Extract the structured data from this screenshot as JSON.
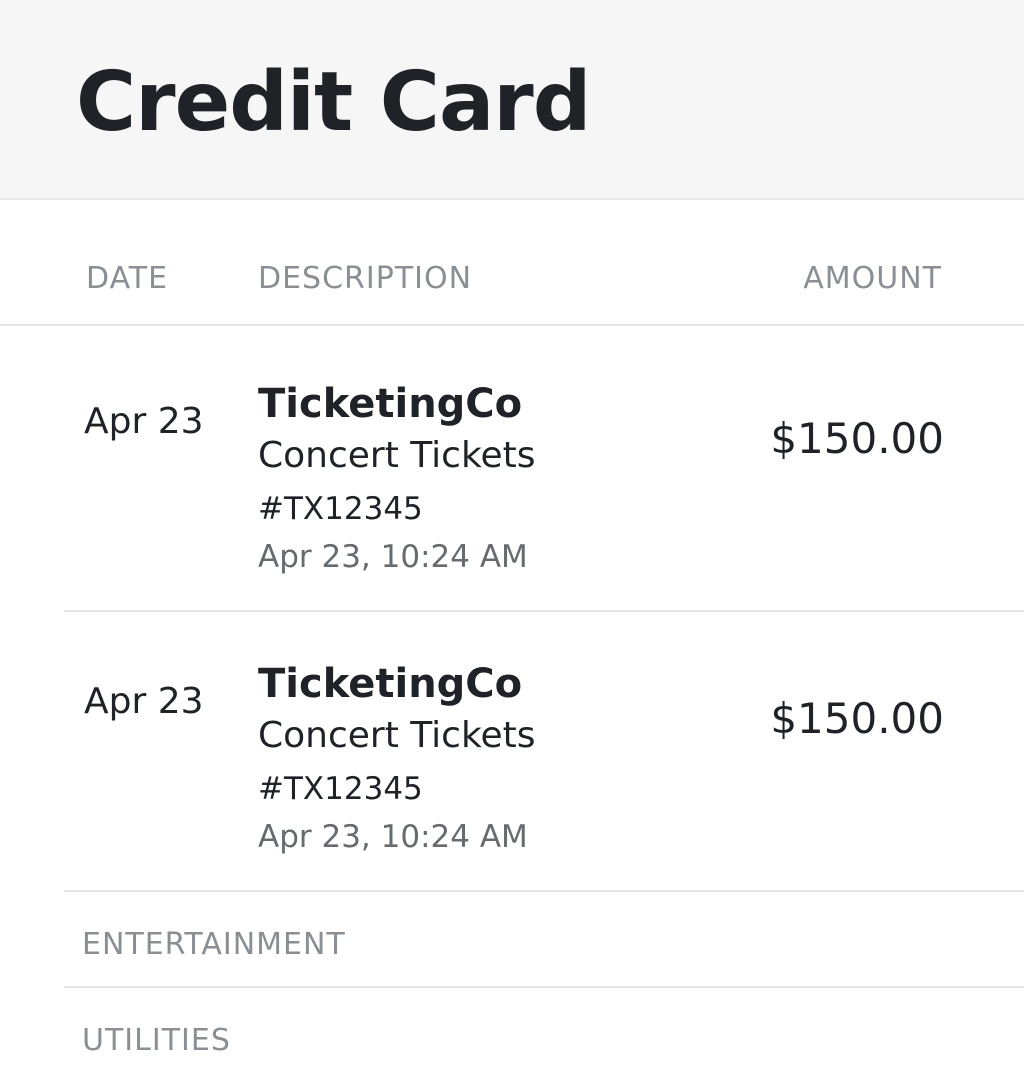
{
  "header": {
    "title": "Credit Card"
  },
  "table": {
    "columns": {
      "date": "DATE",
      "description": "DESCRIPTION",
      "amount": "AMOUNT"
    },
    "transactions": [
      {
        "date": "Apr 23",
        "merchant": "TicketingCo",
        "description": "Concert Tickets",
        "reference": "#TX12345",
        "timestamp": "Apr 23, 10:24 AM",
        "amount": "$150.00"
      },
      {
        "date": "Apr 23",
        "merchant": "TicketingCo",
        "description": "Concert Tickets",
        "reference": "#TX12345",
        "timestamp": "Apr 23, 10:24 AM",
        "amount": "$150.00"
      }
    ],
    "categories": [
      {
        "label": "ENTERTAINMENT"
      },
      {
        "label": "UTILITIES"
      }
    ]
  },
  "colors": {
    "header_bg": "#f6f6f6",
    "text_primary": "#1f2328",
    "text_muted": "#8a8f94",
    "divider": "#e6e6e6"
  }
}
